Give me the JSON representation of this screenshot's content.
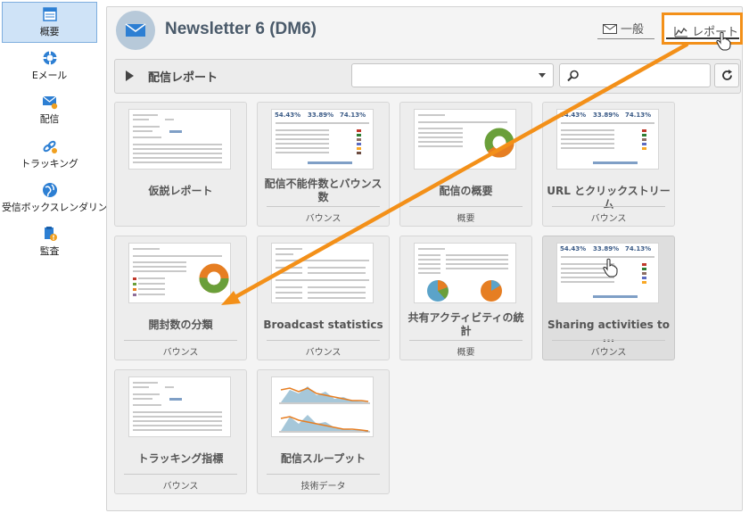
{
  "sidebar": {
    "items": [
      {
        "label": "概要",
        "icon": "overview-icon"
      },
      {
        "label": "Eメール",
        "icon": "email-icon"
      },
      {
        "label": "配信",
        "icon": "delivery-icon"
      },
      {
        "label": "トラッキング",
        "icon": "tracking-icon"
      },
      {
        "label": "受信ボックスレンダリング",
        "icon": "inbox-rendering-icon"
      },
      {
        "label": "監査",
        "icon": "audit-icon"
      }
    ]
  },
  "header": {
    "title": "Newsletter 6 (DM6)",
    "tabs": [
      {
        "label": "一般",
        "icon": "envelope-icon"
      },
      {
        "label": "レポート",
        "icon": "chart-line-icon"
      }
    ]
  },
  "toolbar": {
    "label": "配信レポート",
    "select_value": "",
    "search_value": ""
  },
  "reports": [
    {
      "title": "仮説レポート",
      "category": ""
    },
    {
      "title": "配信不能件数とバウンス数",
      "category": "バウンス"
    },
    {
      "title": "配信の概要",
      "category": "概要"
    },
    {
      "title": "URL とクリックストリーム",
      "category": "バウンス"
    },
    {
      "title": "開封数の分類",
      "category": "バウンス"
    },
    {
      "title": "Broadcast statistics",
      "category": "バウンス"
    },
    {
      "title": "共有アクティビティの統計",
      "category": "概要"
    },
    {
      "title": "Sharing activities to ...",
      "category": "バウンス"
    },
    {
      "title": "トラッキング指標",
      "category": "バウンス"
    },
    {
      "title": "配信スループット",
      "category": "技術データ"
    }
  ],
  "thumb_stats": [
    "54.43%",
    "33.89%",
    "74.13%"
  ],
  "colors": {
    "highlight": "#f39019",
    "active_sidebar": "#cfe3f7",
    "accent_blue": "#2d7fd3"
  }
}
